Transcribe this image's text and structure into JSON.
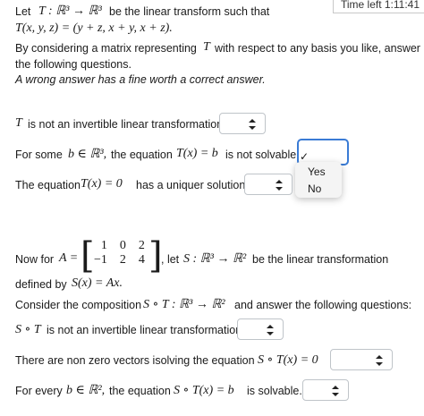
{
  "timer": "Time left 1:11:41",
  "intro": {
    "line1a": "Let",
    "line1b": "be the linear transform  such that",
    "map": "T : ℝ³ → ℝ³",
    "formula": "T(x, y, z) = (y + z, x + y, x + z).",
    "line3": "By considering a matrix representing",
    "line3b": "with respect to any basis you like, answer",
    "line4": "the following questions.",
    "warning": "A wrong answer has a fine worth a correct answer."
  },
  "q1": {
    "math": "T",
    "text": "is not an invertible linear transformation"
  },
  "q2": {
    "pre": "For some",
    "math1": "b ∈ ℝ³,",
    "mid": "the equation",
    "math2": "T(x) = b",
    "post": "is not solvable"
  },
  "q3": {
    "pre": "The equation",
    "math": "T(x) = 0",
    "post": "has a uniquer solution."
  },
  "dropdown_menu": {
    "checked": "✓",
    "options": [
      "Yes",
      "No"
    ]
  },
  "part2": {
    "now_for": "Now for",
    "A_eq": "A =",
    "matrix": [
      [
        "1",
        "0",
        "2"
      ],
      [
        "−1",
        "2",
        "4"
      ]
    ],
    "let": ", let",
    "map": "S : ℝ³ → ℝ²",
    "tail": "be the linear transformation",
    "defined": "defined by",
    "def_math": "S(x) = Ax.",
    "consider": "Consider the composition",
    "comp_math": "S ∘ T : ℝ³ → ℝ²",
    "consider_tail": "and answer the following questions:"
  },
  "q4": {
    "math": "S ∘ T",
    "text": "is not an invertible linear transformation"
  },
  "q5": {
    "pre": "There are non zero vectors  isolving  the equation",
    "math": "S ∘ T(x) = 0"
  },
  "q6": {
    "pre": "For every",
    "math1": "b ∈ ℝ²,",
    "mid": "the equation",
    "math2": "S ∘ T(x) = b",
    "post": "is solvable."
  }
}
